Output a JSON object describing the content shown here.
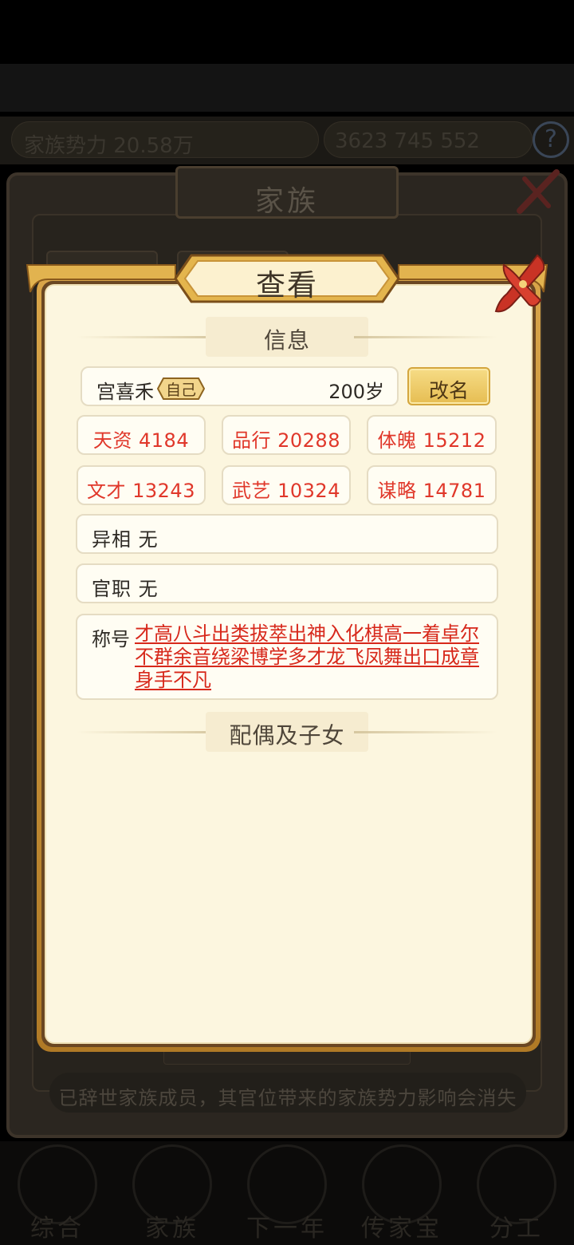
{
  "background": {
    "stats": {
      "family_power": "家族势力 20.58万",
      "values": "3623  745  552"
    },
    "window_title": "家族",
    "notice": "已辞世家族成员，其官位带来的家族势力影响会消失",
    "nav": [
      "综合",
      "家族",
      "下一年",
      "传家宝",
      "分工"
    ]
  },
  "dialog": {
    "title": "查看",
    "sections": {
      "info": "信息",
      "family": "配偶及子女"
    },
    "member": {
      "name": "宫喜禾",
      "self_tag": "自己",
      "age": "200岁"
    },
    "rename_label": "改名",
    "attributes": [
      {
        "label": "天资 4184"
      },
      {
        "label": "品行 20288"
      },
      {
        "label": "体魄 15212"
      },
      {
        "label": "文才 13243"
      },
      {
        "label": "武艺 10324"
      },
      {
        "label": "谋略 14781"
      }
    ],
    "traits": {
      "appearance": "异相 无",
      "office": "官职 无"
    },
    "titles_label": "称号",
    "titles": [
      "才高八斗",
      "出类拔萃",
      "出神入化",
      "棋高一着",
      "卓尔不群",
      "余音绕梁",
      "博学多才",
      "龙飞凤舞",
      "出口成章",
      "身手不凡"
    ]
  },
  "colors": {
    "attr_red": "#e0372a",
    "title_red": "#d7281b",
    "frame_gold": "#d9a549",
    "paper": "#fcf6df"
  },
  "icons": [
    "close-icon",
    "help-icon",
    "ornament-divider"
  ]
}
